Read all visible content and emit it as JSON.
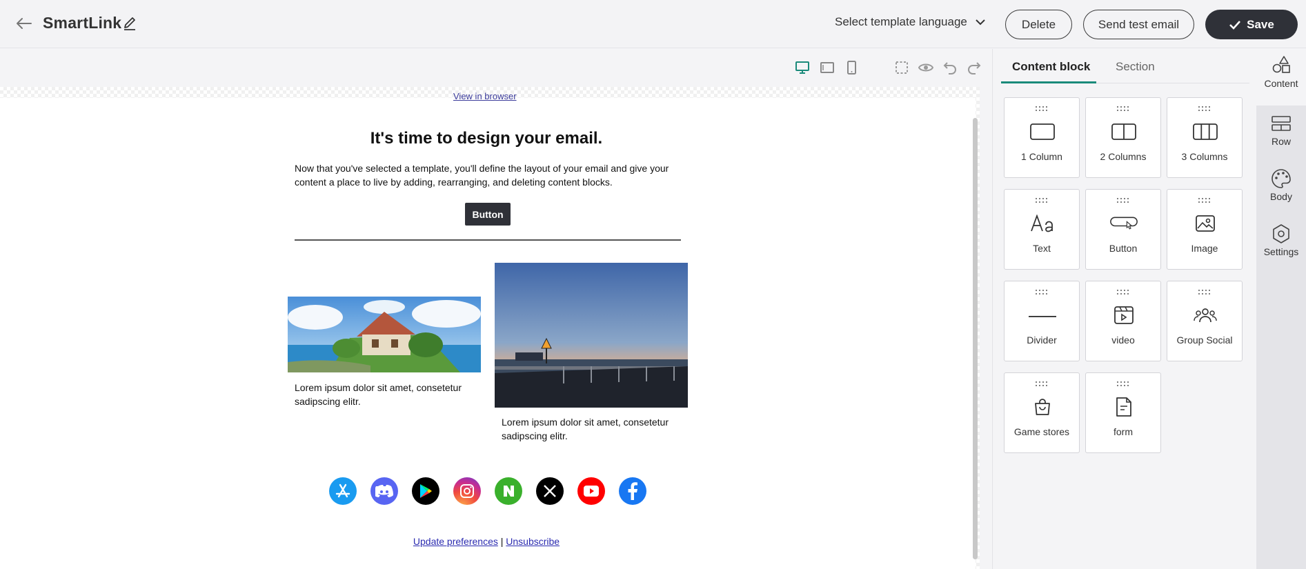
{
  "header": {
    "title": "SmartLink",
    "language_select": "Select template language",
    "delete_label": "Delete",
    "send_test_label": "Send test email",
    "save_label": "Save"
  },
  "email": {
    "view_in_browser": "View in browser",
    "heading": "It's time to design your email.",
    "body": "Now that you've selected a template, you'll define the layout of your email and give your content a place to live by adding, rearranging, and deleting content blocks.",
    "button_label": "Button",
    "caption_left": "Lorem ipsum dolor sit amet, consetetur sadipscing elitr.",
    "caption_right": "Lorem ipsum dolor sit amet, consetetur sadipscing elitr.",
    "footer_update": "Update preferences",
    "footer_separator": "|",
    "footer_unsubscribe": "Unsubscribe",
    "social_icons": [
      "app-store-icon",
      "discord-icon",
      "google-play-icon",
      "instagram-icon",
      "naver-icon",
      "x-icon",
      "youtube-icon",
      "facebook-icon"
    ]
  },
  "panel": {
    "tabs": [
      {
        "label": "Content block",
        "active": true
      },
      {
        "label": "Section",
        "active": false
      }
    ],
    "tiles": [
      {
        "label": "1 Column",
        "icon": "one-column-icon"
      },
      {
        "label": "2 Columns",
        "icon": "two-columns-icon"
      },
      {
        "label": "3 Columns",
        "icon": "three-columns-icon"
      },
      {
        "label": "Text",
        "icon": "text-icon"
      },
      {
        "label": "Button",
        "icon": "button-icon"
      },
      {
        "label": "Image",
        "icon": "image-icon"
      },
      {
        "label": "Divider",
        "icon": "divider-icon"
      },
      {
        "label": "video",
        "icon": "video-icon"
      },
      {
        "label": "Group Social",
        "icon": "group-social-icon"
      },
      {
        "label": "Game stores",
        "icon": "game-stores-icon"
      },
      {
        "label": "form",
        "icon": "form-icon"
      }
    ]
  },
  "right_nav": [
    {
      "label": "Content",
      "icon": "shapes-icon",
      "active": true
    },
    {
      "label": "Row",
      "icon": "row-icon",
      "active": false
    },
    {
      "label": "Body",
      "icon": "palette-icon",
      "active": false
    },
    {
      "label": "Settings",
      "icon": "settings-icon",
      "active": false
    }
  ],
  "colors": {
    "accent": "#1a8a7a",
    "save_bg": "#2f3138",
    "device_active": "#1a8a7a"
  }
}
